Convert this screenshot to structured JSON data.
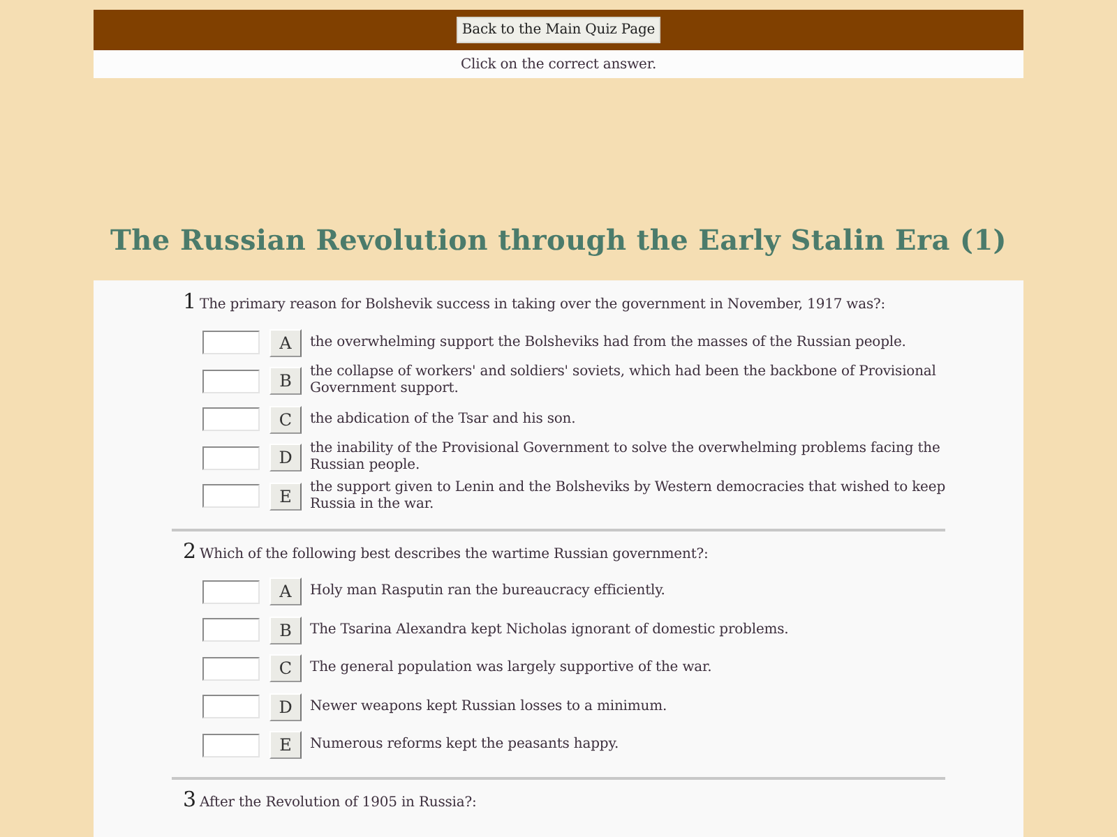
{
  "nav": {
    "back_button": "Back to the Main Quiz Page",
    "instruction": "Click on the correct answer."
  },
  "title": "The Russian Revolution through the Early Stalin Era (1)",
  "questions": [
    {
      "number": "1",
      "text": "The primary reason for Bolshevik success in taking over the government in November, 1917 was?:",
      "answers": [
        {
          "letter": "A",
          "text": "the overwhelming support the Bolsheviks had from the masses of the Russian people."
        },
        {
          "letter": "B",
          "text": "the collapse of workers' and soldiers' soviets, which had been the backbone of Provisional Government support."
        },
        {
          "letter": "C",
          "text": "the abdication of the Tsar and his son."
        },
        {
          "letter": "D",
          "text": "the inability of the Provisional Government to solve the overwhelming problems facing the Russian people."
        },
        {
          "letter": "E",
          "text": "the support given to Lenin and the Bolsheviks by Western democracies that wished to keep Russia in the war."
        }
      ]
    },
    {
      "number": "2",
      "text": "Which of the following best describes the wartime Russian government?:",
      "answers": [
        {
          "letter": "A",
          "text": "Holy man Rasputin ran the bureaucracy efficiently."
        },
        {
          "letter": "B",
          "text": "The Tsarina Alexandra kept Nicholas ignorant of domestic problems."
        },
        {
          "letter": "C",
          "text": "The general population was largely supportive of the war."
        },
        {
          "letter": "D",
          "text": "Newer weapons kept Russian losses to a minimum."
        },
        {
          "letter": "E",
          "text": "Numerous reforms kept the peasants happy."
        }
      ]
    },
    {
      "number": "3",
      "text": "After the Revolution of 1905 in Russia?:"
    }
  ]
}
